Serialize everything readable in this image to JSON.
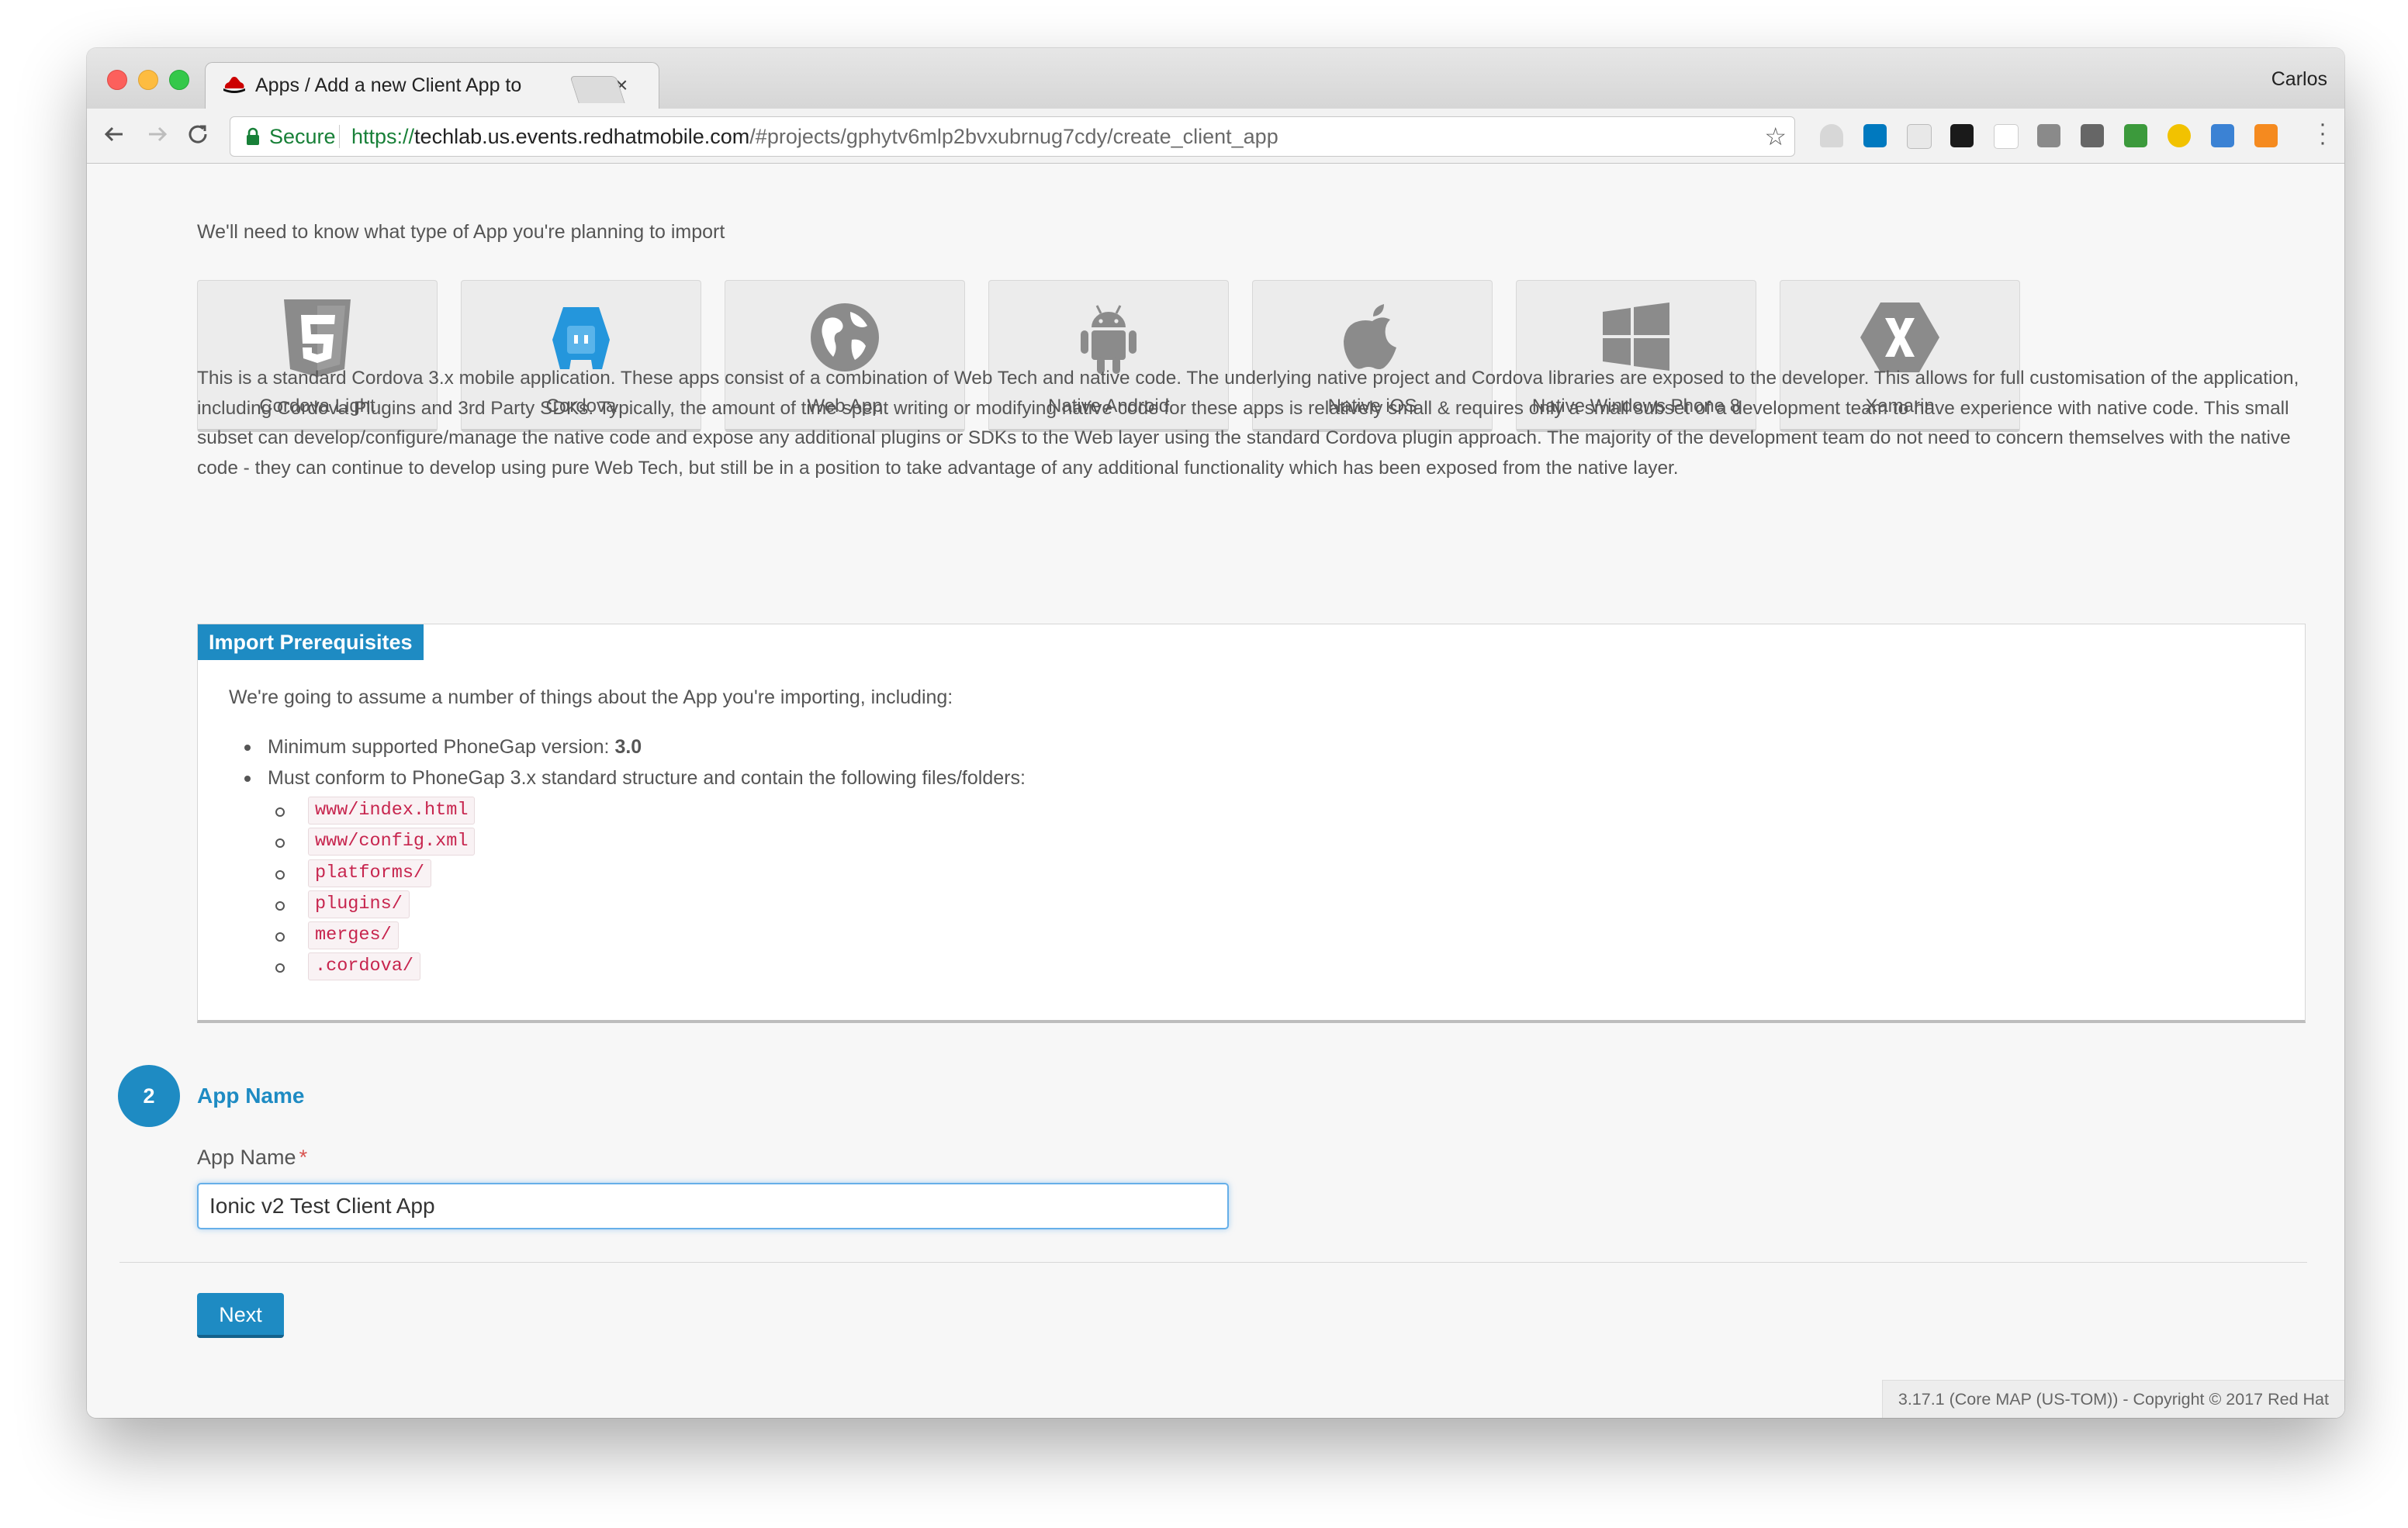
{
  "browser": {
    "tab_title": "Apps / Add a new Client App to",
    "profile_name": "Carlos",
    "secure_label": "Secure",
    "url_protocol": "https://",
    "url_host": "techlab.us.events.redhatmobile.com",
    "url_path": "/#projects/gphytv6mlp2bvxubrnug7cdy/create_client_app",
    "extensions": [
      "drive-icon",
      "trello-icon",
      "readability-icon",
      "pixel-icon",
      "b-icon",
      "pocket-icon",
      "mail-icon",
      "cors-icon",
      "moon-icon",
      "screen-icon",
      "analytics-icon"
    ]
  },
  "page": {
    "intro": "We'll need to know what type of App you're planning to import",
    "app_types": [
      {
        "label": "Cordova Light",
        "icon": "html5-icon"
      },
      {
        "label": "Cordova",
        "icon": "cordova-icon"
      },
      {
        "label": "Web App",
        "icon": "globe-icon"
      },
      {
        "label": "Native Android",
        "icon": "android-icon"
      },
      {
        "label": "Native iOS",
        "icon": "apple-icon"
      },
      {
        "label": "Native Windows Phone 8",
        "icon": "windows-icon"
      },
      {
        "label": "Xamarin",
        "icon": "xamarin-icon"
      }
    ],
    "description": "This is a standard Cordova 3.x mobile application. These apps consist of a combination of Web Tech and native code. The underlying native project and Cordova libraries are exposed to the developer. This allows for full customisation of the application, including Cordova Plugins and 3rd Party SDKs. Typically, the amount of time spent writing or modifying native code for these apps is relatively small & requires only a small subset of a development team to have experience with native code. This small subset can develop/configure/manage the native code and expose any additional plugins or SDKs to the Web layer using the standard Cordova plugin approach. The majority of the development team do not need to concern themselves with the native code - they can continue to develop using pure Web Tech, but still be in a position to take advantage of any additional functionality which has been exposed from the native layer.",
    "prereq": {
      "title": "Import Prerequisites",
      "intro": "We're going to assume a number of things about the App you're importing, including:",
      "min_version_label": "Minimum supported PhoneGap version: ",
      "min_version_value": "3.0",
      "structure_label": "Must conform to PhoneGap 3.x standard structure and contain the following files/folders:",
      "files": [
        "www/index.html",
        "www/config.xml",
        "platforms/",
        "plugins/",
        "merges/",
        ".cordova/"
      ]
    },
    "step": {
      "number": "2",
      "title": "App Name",
      "field_label": "App Name",
      "required_mark": "*",
      "field_value": "Ionic v2 Test Client App"
    },
    "next_label": "Next",
    "footer": "3.17.1 (Core MAP (US-TOM)) - Copyright © 2017 Red Hat"
  },
  "colors": {
    "accent": "#1e8bc3",
    "code_text": "#c7254e",
    "secure_green": "#188038"
  }
}
